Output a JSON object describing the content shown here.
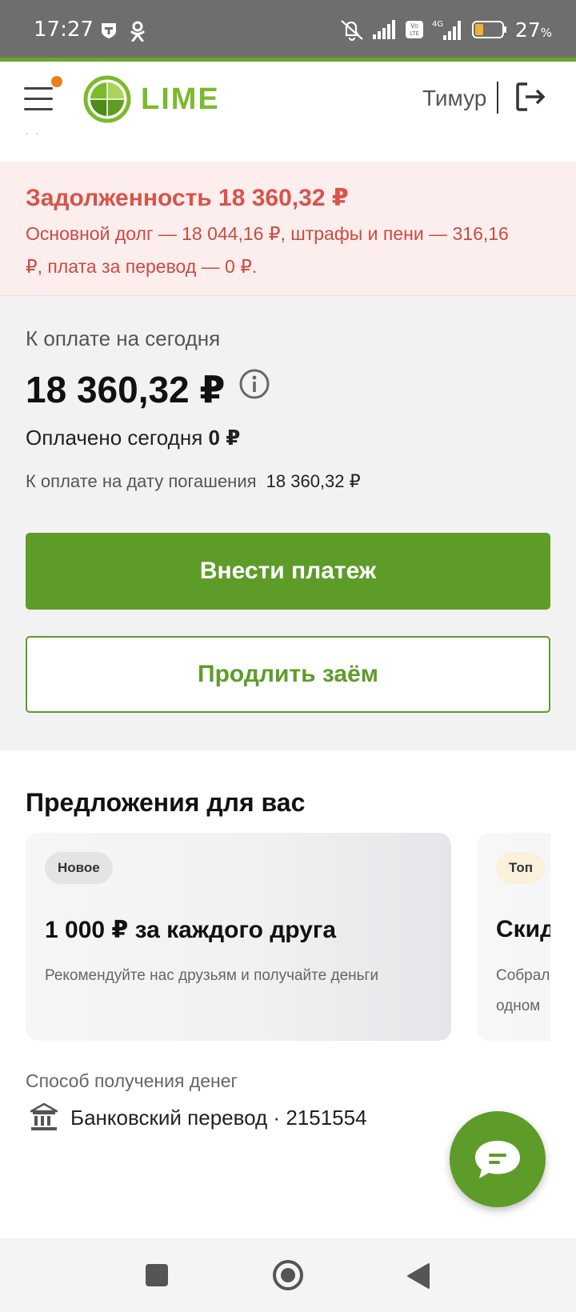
{
  "status_bar": {
    "time": "17:27",
    "battery": "27",
    "battery_unit": "%",
    "network": "4G",
    "volte": "Vo LTE",
    "icons": [
      "tinkoff-icon",
      "odnoklassniki-icon",
      "mute-icon",
      "signal-icon",
      "battery-icon"
    ]
  },
  "header": {
    "logo_text": "LIME",
    "user_name": "Тимур",
    "dots": ". ."
  },
  "debt": {
    "title": "Задолженность 18 360,32 ₽",
    "description": "Основной долг — 18 044,16 ₽, штрафы и пени — 316,16 ₽, плата за перевод — 0 ₽."
  },
  "payment": {
    "label": "К оплате на сегодня",
    "amount": "18 360,32 ₽",
    "paid_today_label": "Оплачено сегодня",
    "paid_today_value": "0 ₽",
    "due_label": "К оплате на дату погашения",
    "due_value": "18 360,32 ₽",
    "primary_button": "Внести платеж",
    "secondary_button": "Продлить заём"
  },
  "offers": {
    "title": "Предложения для вас",
    "cards": [
      {
        "badge": "Новое",
        "title": "1 000 ₽ за каждого друга",
        "description": "Рекомендуйте нас друзьям и получайте деньги"
      },
      {
        "badge": "Топ",
        "title": "Скид",
        "description": "Собрал одном"
      }
    ]
  },
  "receive": {
    "label": "Способ получения денег",
    "value": "Банковский перевод · 2151554"
  },
  "colors": {
    "brand_green": "#5e9c29",
    "logo_green": "#7cba2b",
    "debt_red": "#d9534a",
    "debt_bg": "#fdeeee",
    "notification_orange": "#ef7d19"
  }
}
